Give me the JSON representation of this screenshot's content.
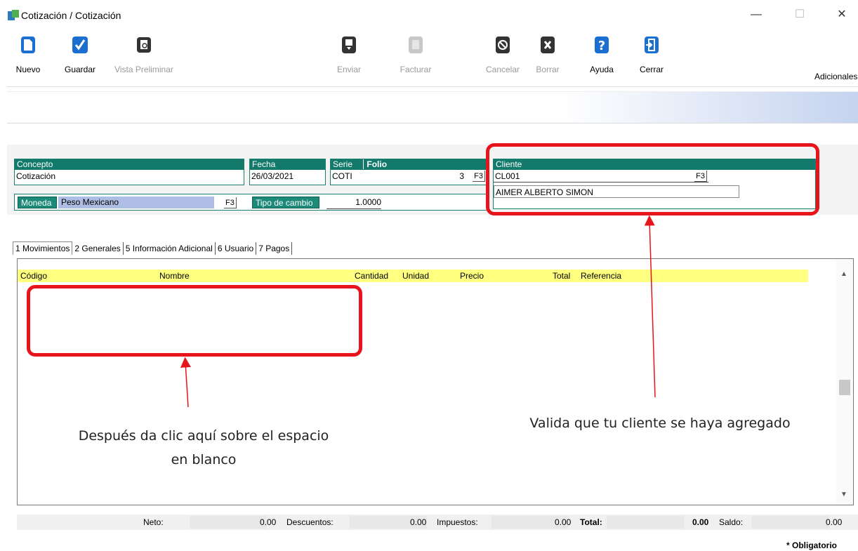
{
  "window": {
    "title": "Cotización / Cotización",
    "minimize": "—",
    "maximize": "☐",
    "close": "✕"
  },
  "toolbar": {
    "nuevo": "Nuevo",
    "guardar": "Guardar",
    "vista_preliminar": "Vista Preliminar",
    "enviar": "Enviar",
    "facturar": "Facturar",
    "cancelar": "Cancelar",
    "borrar": "Borrar",
    "ayuda": "Ayuda",
    "cerrar": "Cerrar",
    "adicionales": "Adicionales"
  },
  "form": {
    "concepto": {
      "label": "Concepto",
      "value": "Cotización"
    },
    "fecha": {
      "label": "Fecha",
      "value": "26/03/2021"
    },
    "serie": {
      "label": "Serie",
      "value": "COTI"
    },
    "folio": {
      "label": "Folio",
      "value": "3"
    },
    "f3": "F3",
    "cliente": {
      "label": "Cliente",
      "code": "CL001",
      "name": "AIMER ALBERTO SIMON"
    },
    "moneda": {
      "label": "Moneda",
      "value": "Peso Mexicano"
    },
    "tipo_cambio": {
      "label": "Tipo de cambio",
      "value": "1.0000"
    }
  },
  "tabs": [
    "1 Movimientos",
    "2 Generales",
    "5 Información Adicional",
    "6 Usuario",
    "7 Pagos"
  ],
  "grid": {
    "columns": [
      "Código",
      "Nombre",
      "Cantidad",
      "Unidad",
      "Precio",
      "Total",
      "Referencia"
    ]
  },
  "totals": {
    "neto_label": "Neto:",
    "neto": "0.00",
    "descuentos_label": "Descuentos:",
    "descuentos": "0.00",
    "impuestos_label": "Impuestos:",
    "impuestos": "0.00",
    "total_label": "Total:",
    "total": "0.00",
    "saldo_label": "Saldo:",
    "saldo": "0.00"
  },
  "obligatorio": "* Obligatorio",
  "annotations": {
    "left": "Después da clic aquí sobre el espacio en blanco",
    "right": "Valida que tu cliente se haya agregado"
  },
  "colors": {
    "teal": "#137a6b",
    "highlight_red": "#e8141b",
    "grid_header": "#ffff80",
    "toolbar_blue": "#1a6fd0"
  }
}
